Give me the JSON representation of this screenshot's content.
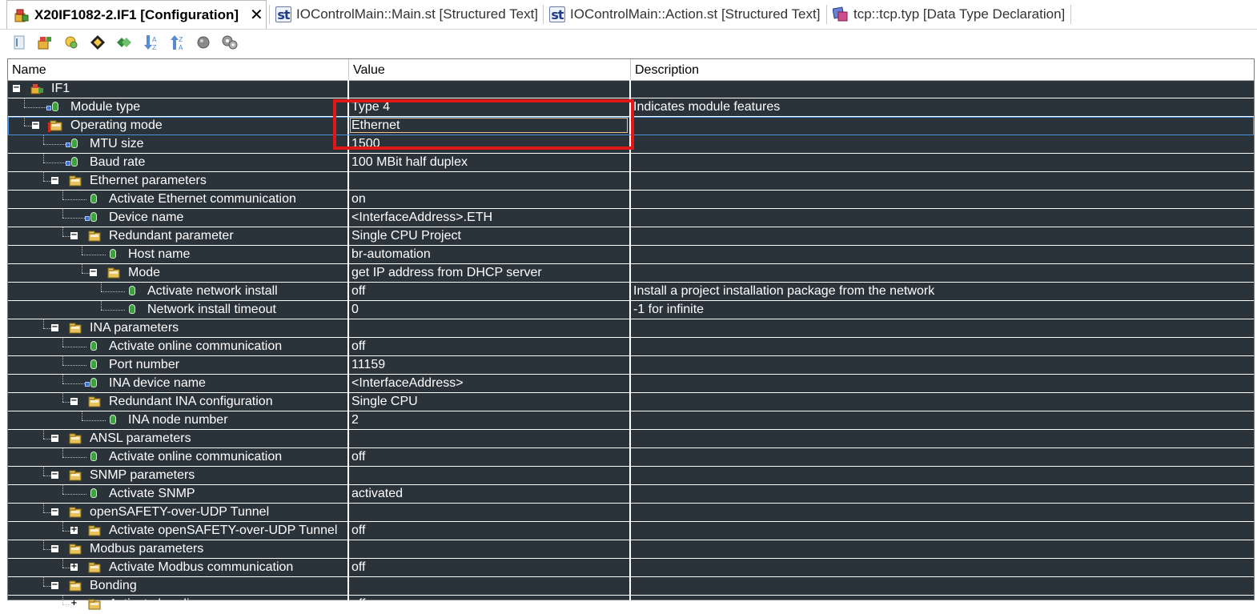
{
  "tabs": [
    {
      "label": "X20IF1082-2.IF1 [Configuration]",
      "icon": "config-icon",
      "active": true,
      "close": "✕"
    },
    {
      "label": "IOControlMain::Main.st [Structured Text]",
      "icon": "st-file-icon"
    },
    {
      "label": "IOControlMain::Action.st [Structured Text]",
      "icon": "st-file-icon"
    },
    {
      "label": "tcp::tcp.typ [Data Type Declaration]",
      "icon": "datatype-icon"
    }
  ],
  "st_icon_text": "st",
  "toolbar": [
    "properties-icon",
    "add-icon",
    "edit-icon",
    "navigate-icon",
    "link-icon",
    "sort-descending-icon",
    "sort-ascending-icon",
    "circle-icon",
    "gears-icon"
  ],
  "columns": {
    "name": "Name",
    "value": "Value",
    "description": "Description"
  },
  "rows": [
    {
      "level": 0,
      "type": "root",
      "toggle": "−",
      "name": "IF1",
      "value": "",
      "desc": ""
    },
    {
      "level": 1,
      "type": "param",
      "lock": true,
      "name": "Module type",
      "value": "Type 4",
      "desc": "Indicates module features"
    },
    {
      "level": 1,
      "type": "group",
      "toggle": "−",
      "mark": true,
      "selected": true,
      "name": "Operating mode",
      "value": "Ethernet",
      "desc": ""
    },
    {
      "level": 2,
      "type": "param",
      "lock": true,
      "name": "MTU size",
      "value": "1500",
      "desc": ""
    },
    {
      "level": 2,
      "type": "param",
      "lock": true,
      "name": "Baud rate",
      "value": "100 MBit half duplex",
      "desc": ""
    },
    {
      "level": 2,
      "type": "group",
      "toggle": "−",
      "name": "Ethernet parameters",
      "value": "",
      "desc": ""
    },
    {
      "level": 3,
      "type": "param",
      "name": "Activate Ethernet communication",
      "value": "on",
      "desc": ""
    },
    {
      "level": 3,
      "type": "param",
      "lock": true,
      "name": "Device name",
      "value": "<InterfaceAddress>.ETH",
      "desc": ""
    },
    {
      "level": 3,
      "type": "group",
      "toggle": "−",
      "name": "Redundant parameter",
      "value": "Single CPU Project",
      "desc": ""
    },
    {
      "level": 4,
      "type": "param",
      "name": "Host name",
      "value": "br-automation",
      "desc": ""
    },
    {
      "level": 4,
      "type": "group",
      "toggle": "−",
      "name": "Mode",
      "value": "get IP address from DHCP server",
      "desc": ""
    },
    {
      "level": 5,
      "type": "param",
      "name": "Activate network install",
      "value": "off",
      "desc": "Install a project installation package from the network"
    },
    {
      "level": 5,
      "type": "param",
      "name": "Network install timeout",
      "value": "0",
      "desc": "-1 for infinite"
    },
    {
      "level": 2,
      "type": "group",
      "toggle": "−",
      "name": "INA parameters",
      "value": "",
      "desc": ""
    },
    {
      "level": 3,
      "type": "param",
      "name": "Activate online communication",
      "value": "off",
      "desc": ""
    },
    {
      "level": 3,
      "type": "param",
      "name": "Port number",
      "value": "11159",
      "desc": ""
    },
    {
      "level": 3,
      "type": "param",
      "lock": true,
      "name": "INA device name",
      "value": "<InterfaceAddress>",
      "desc": ""
    },
    {
      "level": 3,
      "type": "group",
      "toggle": "−",
      "name": "Redundant INA configuration",
      "value": "Single CPU",
      "desc": ""
    },
    {
      "level": 4,
      "type": "param",
      "name": "INA node number",
      "value": "2",
      "desc": ""
    },
    {
      "level": 2,
      "type": "group",
      "toggle": "−",
      "name": "ANSL parameters",
      "value": "",
      "desc": ""
    },
    {
      "level": 3,
      "type": "param",
      "name": "Activate online communication",
      "value": "off",
      "desc": ""
    },
    {
      "level": 2,
      "type": "group",
      "toggle": "−",
      "name": "SNMP parameters",
      "value": "",
      "desc": ""
    },
    {
      "level": 3,
      "type": "param",
      "name": "Activate SNMP",
      "value": "activated",
      "desc": ""
    },
    {
      "level": 2,
      "type": "group",
      "toggle": "−",
      "name": "openSAFETY-over-UDP Tunnel",
      "value": "",
      "desc": ""
    },
    {
      "level": 3,
      "type": "group",
      "toggle": "+",
      "name": "Activate openSAFETY-over-UDP Tunnel",
      "value": "off",
      "desc": ""
    },
    {
      "level": 2,
      "type": "group",
      "toggle": "−",
      "name": "Modbus parameters",
      "value": "",
      "desc": ""
    },
    {
      "level": 3,
      "type": "group",
      "toggle": "+",
      "name": "Activate Modbus communication",
      "value": "off",
      "desc": ""
    },
    {
      "level": 2,
      "type": "group",
      "toggle": "−",
      "name": "Bonding",
      "value": "",
      "desc": ""
    },
    {
      "level": 3,
      "type": "group",
      "toggle": "+",
      "name": "Activate bonding",
      "value": "off",
      "desc": ""
    }
  ]
}
